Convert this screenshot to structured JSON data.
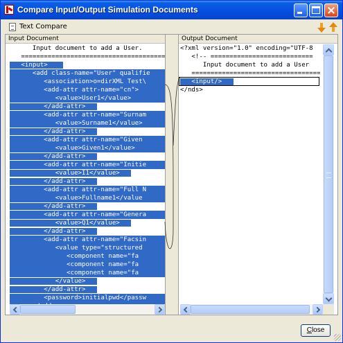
{
  "window": {
    "title": "Compare Input/Output Simulation Documents"
  },
  "toolbar": {
    "text_compare_label": "Text Compare",
    "close_label_access": "C",
    "close_label_rest": "lose"
  },
  "panels": {
    "input_header": "Input Document",
    "output_header": "Output Document"
  },
  "input_lines": [
    {
      "text": "      Input document to add a User.",
      "hl": false
    },
    {
      "text": "   ===========================================",
      "hl": false
    },
    {
      "text": "   <input>",
      "hl": true,
      "pad": 4
    },
    {
      "text": "      <add class-name=\"User\" qualifie",
      "hl": true
    },
    {
      "text": "         <association>o=dirXML Test\\",
      "hl": true
    },
    {
      "text": "         <add-attr attr-name=\"cn\">",
      "hl": true
    },
    {
      "text": "            <value>User1</value>",
      "hl": true
    },
    {
      "text": "         </add-attr>",
      "hl": true,
      "pad": 3
    },
    {
      "text": "         <add-attr attr-name=\"Surnam",
      "hl": true
    },
    {
      "text": "            <value>Surname1</value>",
      "hl": true
    },
    {
      "text": "         </add-attr>",
      "hl": true,
      "pad": 3
    },
    {
      "text": "         <add-attr attr-name=\"Given ",
      "hl": true
    },
    {
      "text": "            <value>Given1</value>",
      "hl": true
    },
    {
      "text": "         </add-attr>",
      "hl": true,
      "pad": 3
    },
    {
      "text": "         <add-attr attr-name=\"Initie",
      "hl": true
    },
    {
      "text": "            <value>I1</value>",
      "hl": true,
      "pad": 3
    },
    {
      "text": "         </add-attr>",
      "hl": true,
      "pad": 3
    },
    {
      "text": "         <add-attr attr-name=\"Full N",
      "hl": true
    },
    {
      "text": "            <value>Fullname1</value",
      "hl": true
    },
    {
      "text": "         </add-attr>",
      "hl": true,
      "pad": 3
    },
    {
      "text": "         <add-attr attr-name=\"Genera",
      "hl": true
    },
    {
      "text": "            <value>Q1</value>",
      "hl": true,
      "pad": 3
    },
    {
      "text": "         </add-attr>",
      "hl": true,
      "pad": 3
    },
    {
      "text": "         <add-attr attr-name=\"Facsin",
      "hl": true
    },
    {
      "text": "            <value type=\"structured",
      "hl": true
    },
    {
      "text": "               <component name=\"fa",
      "hl": true
    },
    {
      "text": "               <component name=\"fa",
      "hl": true
    },
    {
      "text": "               <component name=\"fa",
      "hl": true
    },
    {
      "text": "            </value>",
      "hl": true,
      "pad": 3
    },
    {
      "text": "         </add-attr>",
      "hl": true,
      "pad": 3
    },
    {
      "text": "         <password>initialpwd</passw",
      "hl": true
    },
    {
      "text": "      </add>",
      "hl": true
    }
  ],
  "output_lines": [
    {
      "text": "<?xml version=\"1.0\" encoding=\"UTF-8",
      "hl": false
    },
    {
      "text": "   <!-- ===========================",
      "hl": false
    },
    {
      "text": "      Input document to add a User",
      "hl": false
    },
    {
      "text": "   ===========================================",
      "hl": false
    },
    {
      "text": "   <input/>",
      "hl": true,
      "pad": 3
    },
    {
      "text": "</nds>",
      "hl": false
    }
  ]
}
